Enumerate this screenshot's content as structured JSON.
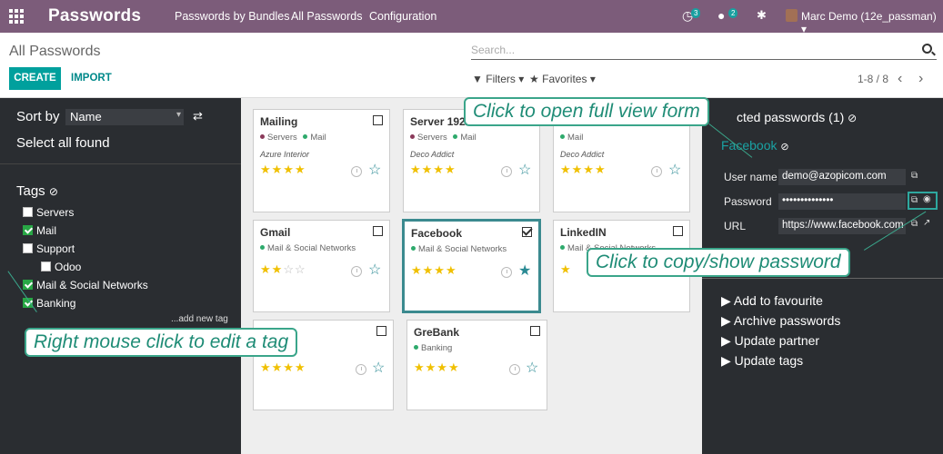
{
  "topbar": {
    "app_title": "Passwords",
    "menu": [
      "Passwords by Bundles",
      "All Passwords",
      "Configuration"
    ],
    "activity_count": "3",
    "messages_count": "2",
    "user": "Marc Demo (12e_passman)"
  },
  "control": {
    "breadcrumb": "All Passwords",
    "search_placeholder": "Search...",
    "create_label": "CREATE",
    "import_label": "IMPORT",
    "filters_label": "Filters",
    "favorites_label": "Favorites",
    "pager": "1-8 / 8"
  },
  "sidebar": {
    "sort_label": "Sort by",
    "sort_value": "Name",
    "select_all": "Select all found",
    "tags_title": "Tags",
    "tags": [
      {
        "label": "Servers",
        "checked": false
      },
      {
        "label": "Mail",
        "checked": true
      },
      {
        "label": "Support",
        "checked": false
      },
      {
        "label": "Odoo",
        "checked": false
      },
      {
        "label": "Mail & Social Networks",
        "checked": true
      },
      {
        "label": "Banking",
        "checked": true
      }
    ],
    "add_tag": "...add new tag"
  },
  "cards": [
    {
      "name": "Mailing",
      "tags": [
        "Servers",
        "Mail"
      ],
      "partner": "Azure Interior",
      "stars": 4,
      "checked": false,
      "favourite": false
    },
    {
      "name": "Server 192/",
      "tags": [
        "Servers",
        "Mail"
      ],
      "partner": "Deco Addict",
      "stars": 4,
      "checked": false,
      "favourite": false
    },
    {
      "name": "",
      "tags": [
        "Mail"
      ],
      "partner": "Deco Addict",
      "stars": 4,
      "checked": false,
      "favourite": false
    },
    {
      "name": "Gmail",
      "tags": [
        "Mail & Social Networks"
      ],
      "partner": "",
      "stars": 2,
      "checked": false,
      "favourite": false
    },
    {
      "name": "Facebook",
      "tags": [
        "Mail & Social Networks"
      ],
      "partner": "",
      "stars": 4,
      "checked": true,
      "favourite": true
    },
    {
      "name": "LinkedIN",
      "tags": [
        "Mail & Social Networks"
      ],
      "partner": "",
      "stars": 1,
      "checked": false,
      "favourite": false
    },
    {
      "name": "",
      "tags": [],
      "partner": "",
      "stars": 4,
      "checked": false,
      "favourite": false
    },
    {
      "name": "GreBank",
      "tags": [
        "Banking"
      ],
      "partner": "",
      "stars": 4,
      "checked": false,
      "favourite": false
    }
  ],
  "right_panel": {
    "header": "cted passwords (1)",
    "selected_name": "Facebook",
    "username_label": "User name",
    "username_value": "demo@azopicom.com",
    "password_label": "Password",
    "password_value": "••••••••••••••",
    "url_label": "URL",
    "url_value": "https://www.facebook.com",
    "actions": [
      "Add to favourite",
      "Archive passwords",
      "Update partner",
      "Update tags"
    ]
  },
  "callouts": {
    "open_form": "Click to open full view form",
    "copy_password": "Click to copy/show password",
    "edit_tag": "Right mouse click to edit a tag"
  },
  "colors": {
    "topbar": "#7c5c7a",
    "accent": "#00a09d",
    "sidebar_bg": "#2a2d31",
    "callout": "#3aa58a"
  }
}
